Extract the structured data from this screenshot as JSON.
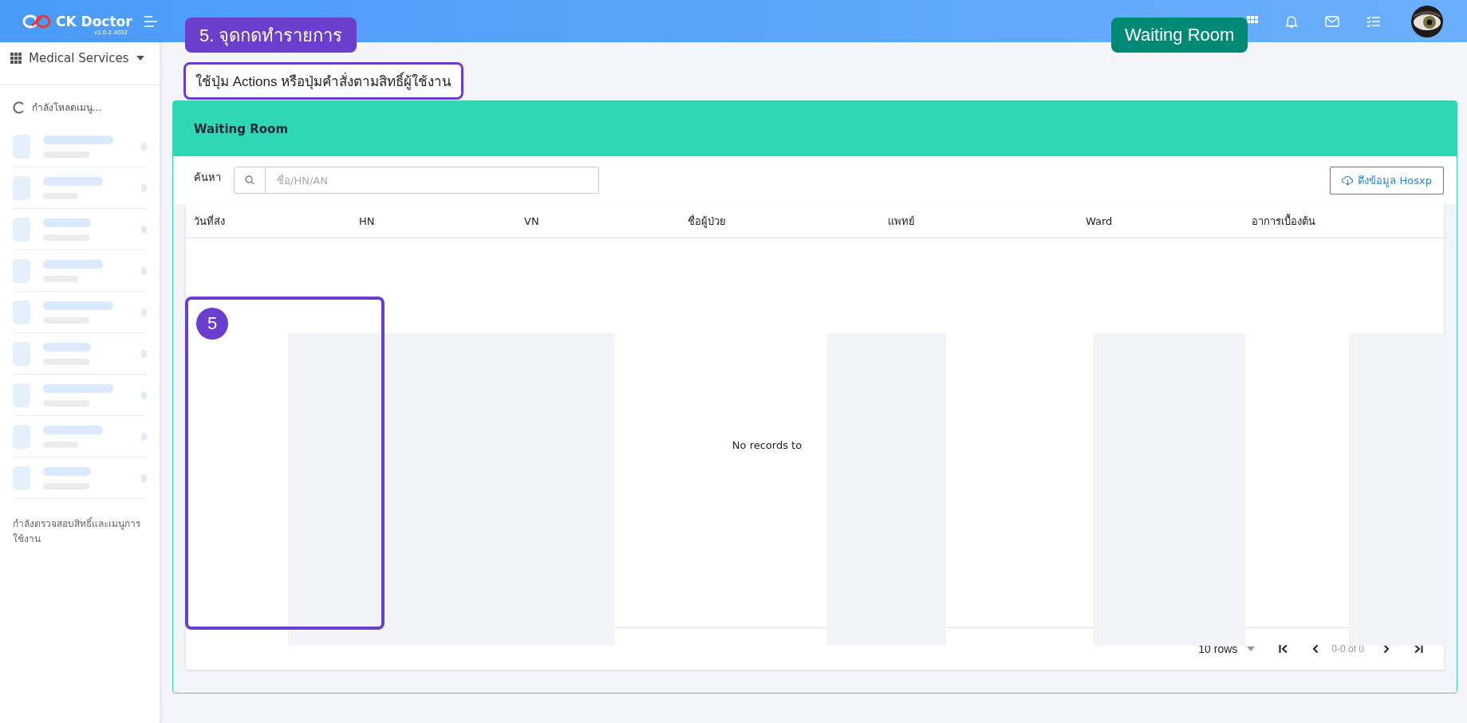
{
  "app": {
    "name": "CK Doctor",
    "version": "v1.0.2.4032"
  },
  "module_menu": {
    "label": "Medical Services"
  },
  "sidebar": {
    "loading_text": "กำลังโหลดเมนู...",
    "skeleton_items": [
      {
        "kind": "long"
      },
      {
        "kind": "medium"
      },
      {
        "kind": "short"
      },
      {
        "kind": "medium"
      },
      {
        "kind": "long"
      },
      {
        "kind": "short"
      },
      {
        "kind": "long"
      },
      {
        "kind": "medium"
      },
      {
        "kind": "short"
      }
    ],
    "footer_text": "กำลังตรวจสอบสิทธิ์และเมนูการใช้งาน"
  },
  "tour": {
    "step_label": "5. จุดกดทำรายการ",
    "hint": "ใช้ปุ่ม Actions หรือปุ่มคำสั่งตามสิทธิ์ผู้ใช้งาน",
    "page_badge": "Waiting Room",
    "marker": "5"
  },
  "panel": {
    "title": "Waiting Room",
    "search_label": "ค้นหา",
    "search_placeholder": "ชื่อ/HN/AN",
    "fetch_button": "ดึงข้อมูล Hosxp"
  },
  "table": {
    "columns": [
      "วันที่ส่ง",
      "HN",
      "VN",
      "ชื่อผู้ป่วย",
      "แพทย์",
      "Ward",
      "อาการเบื้องต้น"
    ],
    "empty_text": "No records to"
  },
  "pagination": {
    "rows_per_page": "10 rows",
    "range": "0-0 of 0"
  }
}
